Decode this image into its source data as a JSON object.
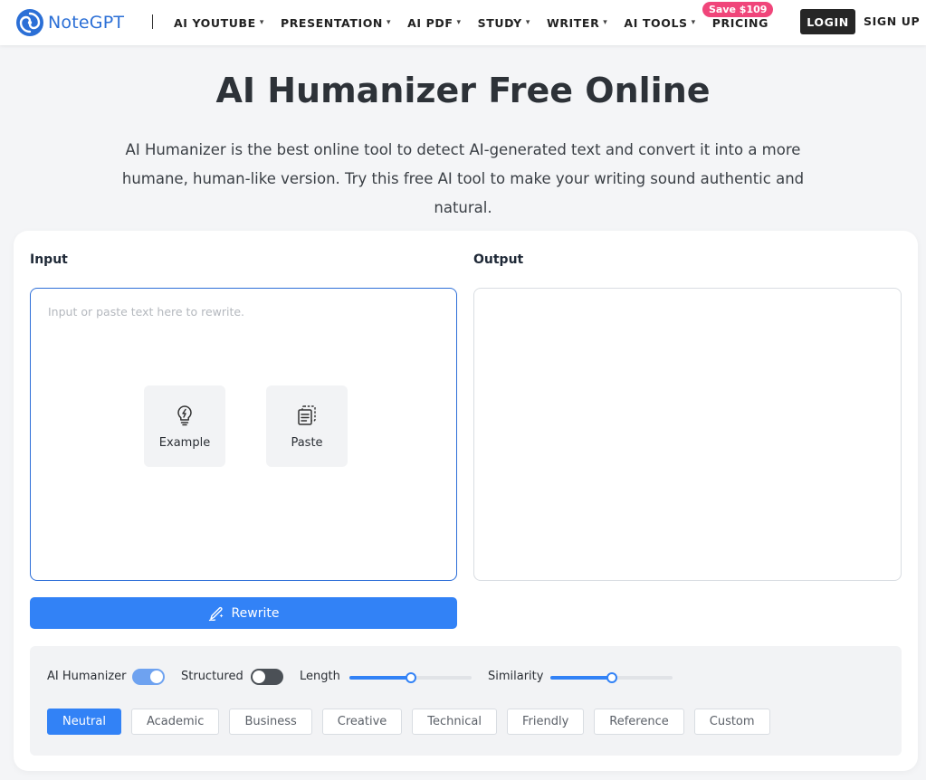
{
  "header": {
    "brand": "NoteGPT",
    "nav": [
      {
        "label": "AI YOUTUBE",
        "has_caret": true
      },
      {
        "label": "PRESENTATION",
        "has_caret": true
      },
      {
        "label": "AI PDF",
        "has_caret": true
      },
      {
        "label": "STUDY",
        "has_caret": true
      },
      {
        "label": "WRITER",
        "has_caret": true
      },
      {
        "label": "AI TOOLS",
        "has_caret": true
      },
      {
        "label": "PRICING",
        "has_caret": false
      }
    ],
    "save_badge": "Save $109",
    "login_label": "LOGIN",
    "signup_label": "SIGN UP"
  },
  "hero": {
    "title": "AI Humanizer Free Online",
    "subtitle": "AI Humanizer is the best online tool to detect AI-generated text and convert it into a more humane, human-like version. Try this free AI tool to make your writing sound authentic and natural."
  },
  "editor": {
    "input_label": "Input",
    "output_label": "Output",
    "input_placeholder": "Input or paste text here to rewrite.",
    "example_label": "Example",
    "paste_label": "Paste",
    "rewrite_label": "Rewrite"
  },
  "options": {
    "ai_humanizer_label": "AI Humanizer",
    "ai_humanizer_on": true,
    "structured_label": "Structured",
    "structured_on": false,
    "length_label": "Length",
    "length_value": 0.5,
    "similarity_label": "Similarity",
    "similarity_value": 0.5,
    "tones": [
      "Neutral",
      "Academic",
      "Business",
      "Creative",
      "Technical",
      "Friendly",
      "Reference",
      "Custom"
    ],
    "active_tone": "Neutral"
  },
  "colors": {
    "brand_blue": "#2b6fd6",
    "accent": "#3282f6",
    "badge_pink": "#f0457a",
    "toggle_on": "#6ea2f0",
    "toggle_off": "#4b5056"
  },
  "icons": [
    "notegpt-logo-icon",
    "lightbulb-icon",
    "clipboard-icon",
    "pen-sparkle-icon"
  ]
}
